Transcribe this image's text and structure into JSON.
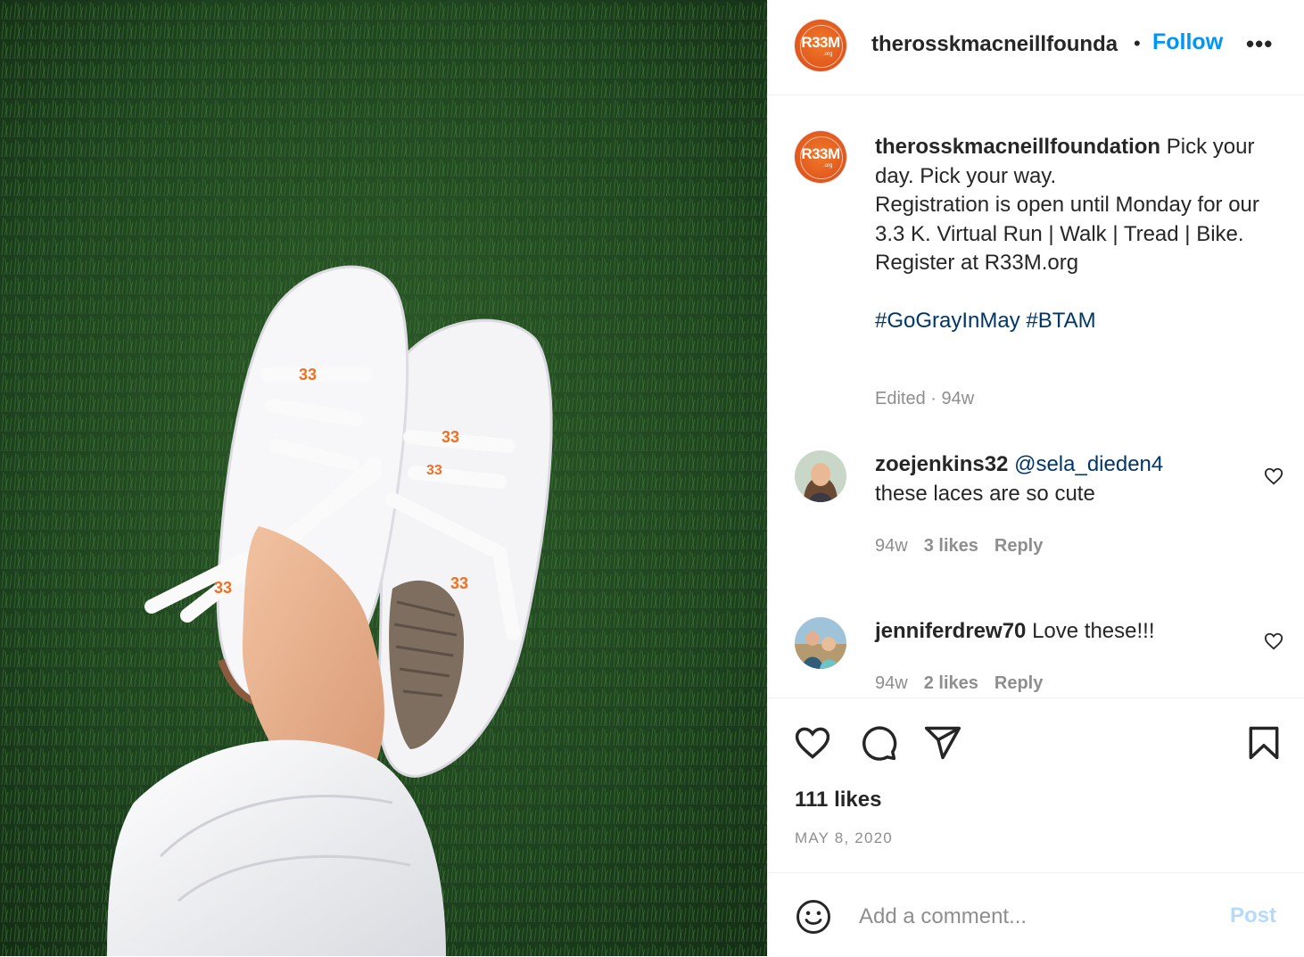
{
  "post": {
    "image_alt": "white sneakers with R33M laces on grass",
    "lace_logo": "R33M"
  },
  "header": {
    "username": "therosskmacneillfounda",
    "separator": "•",
    "follow_label": "Follow",
    "more_icon": "more-horizontal-icon",
    "more_label": "•••",
    "avatar_logo": "R33M",
    "avatar_org": ".org"
  },
  "caption": {
    "username": "therosskmacneillfoundation",
    "line1": "Pick your day. Pick your way.",
    "line2": "Registration is open until Monday for our 3.3 K. Virtual Run | Walk | Tread | Bike.",
    "line3": "Register at R33M.org",
    "hashtags": "#GoGrayInMay #BTAM",
    "edited": "Edited · 94w"
  },
  "comments": [
    {
      "username": "zoejenkins32",
      "mention": "@sela_dieden4",
      "text": "these laces are so cute",
      "age": "94w",
      "likes": "3 likes",
      "reply": "Reply"
    },
    {
      "username": "jenniferdrew70",
      "mention": "",
      "text": "Love these!!!",
      "age": "94w",
      "likes": "2 likes",
      "reply": "Reply"
    }
  ],
  "actions": {
    "icons": [
      "heart-icon",
      "comment-icon",
      "share-icon",
      "bookmark-icon"
    ],
    "likes": "111 likes",
    "date": "MAY 8, 2020"
  },
  "add_comment": {
    "placeholder": "Add a comment...",
    "post_label": "Post",
    "emoji_icon": "emoji-icon"
  },
  "colors": {
    "follow": "#0095f6",
    "hashtag": "#00376b",
    "secondary": "#8e8e8e",
    "post_disabled": "#b3dbff",
    "brand_orange": "#e0561c"
  }
}
